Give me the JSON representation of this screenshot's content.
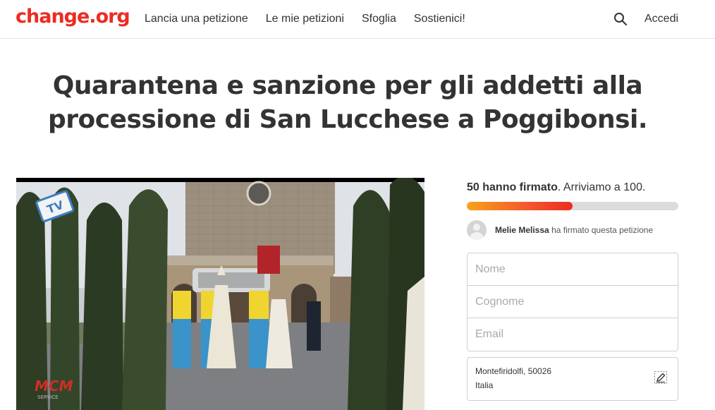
{
  "header": {
    "logo": "change.org",
    "nav": [
      "Lancia una petizione",
      "Le mie petizioni",
      "Sfoglia",
      "Sostienici!"
    ],
    "search_icon": "search-icon",
    "login": "Accedi"
  },
  "petition": {
    "title": "Quarantena e sanzione per gli addetti alla processione di San Lucchese a Poggibonsi.",
    "video_logo_text": "TV",
    "video_watermark": "MCM",
    "video_watermark_sub": "SERVICE"
  },
  "signatures": {
    "count_text": "50 hanno firmato",
    "goal_text": ". Arriviamo a 100.",
    "progress_fraction": 0.5,
    "recent_signer": "Melie Melissa",
    "recent_signer_suffix": "ha firmato questa petizione"
  },
  "form": {
    "first_name_placeholder": "Nome",
    "last_name_placeholder": "Cognome",
    "email_placeholder": "Email",
    "location_line1": "Montefiridolfi, 50026",
    "location_line2": "Italia",
    "edit_icon": "edit-pencil-icon"
  },
  "colors": {
    "brand": "#ec2c22",
    "progress_start": "#f7a21b",
    "progress_end": "#ec2c22"
  }
}
